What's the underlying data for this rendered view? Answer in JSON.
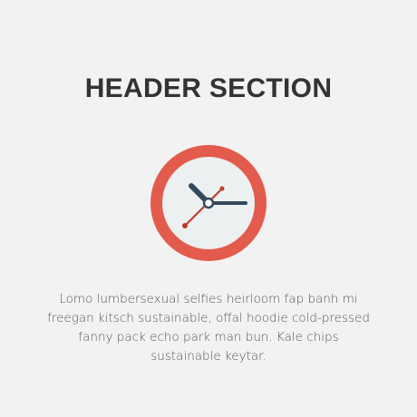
{
  "section": {
    "title": "HEADER SECTION",
    "icon": "clock-icon",
    "body": "Lomo lumbersexual selfies heirloom fap banh mi freegan kitsch sustainable, offal hoodie cold-pressed fanny pack echo park man bun. Kale chips sustainable keytar."
  },
  "colors": {
    "background": "#f2f2f2",
    "title": "#333333",
    "text": "#555555",
    "clock_ring": "#e35b4c",
    "clock_face": "#ecf0f1",
    "hands": "#34495e",
    "second_hand": "#c0392b"
  }
}
